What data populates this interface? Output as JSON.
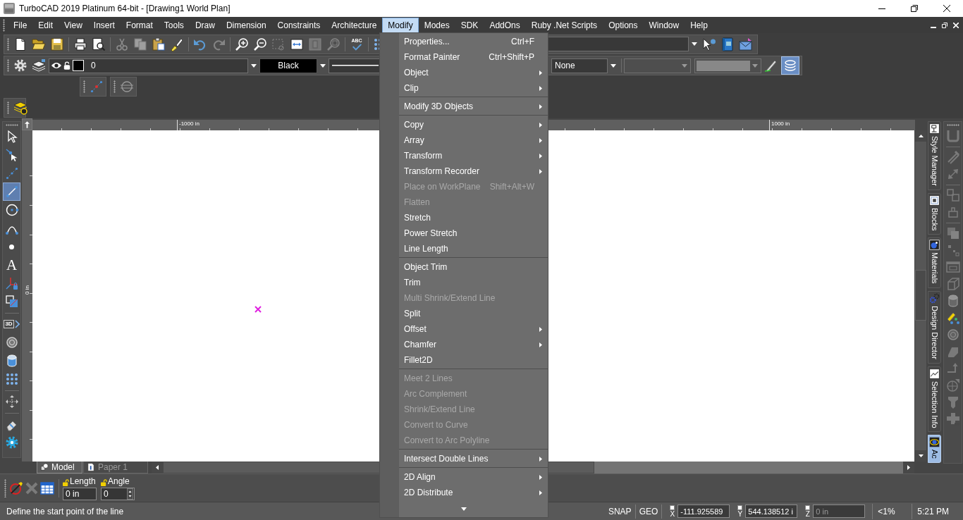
{
  "title_bar": {
    "title": "TurboCAD 2019 Platinum 64-bit - [Drawing1 World Plan]"
  },
  "menu_bar": {
    "items": [
      {
        "label": "File",
        "selected": false
      },
      {
        "label": "Edit",
        "selected": false
      },
      {
        "label": "View",
        "selected": false
      },
      {
        "label": "Insert",
        "selected": false
      },
      {
        "label": "Format",
        "selected": false
      },
      {
        "label": "Tools",
        "selected": false
      },
      {
        "label": "Draw",
        "selected": false
      },
      {
        "label": "Dimension",
        "selected": false
      },
      {
        "label": "Constraints",
        "selected": false
      },
      {
        "label": "Architecture",
        "selected": false
      },
      {
        "label": "Modify",
        "selected": true
      },
      {
        "label": "Modes",
        "selected": false
      },
      {
        "label": "SDK",
        "selected": false
      },
      {
        "label": "AddOns",
        "selected": false
      },
      {
        "label": "Ruby .Net Scripts",
        "selected": false
      },
      {
        "label": "Options",
        "selected": false
      },
      {
        "label": "Window",
        "selected": false
      },
      {
        "label": "Help",
        "selected": false
      }
    ]
  },
  "modify_menu": {
    "more_below": true,
    "items": [
      {
        "kind": "item",
        "label": "Properties...",
        "shortcut": "Ctrl+F",
        "submenu": false,
        "disabled": false
      },
      {
        "kind": "item",
        "label": "Format Painter",
        "shortcut": "Ctrl+Shift+P",
        "submenu": false,
        "disabled": false
      },
      {
        "kind": "item",
        "label": "Object",
        "submenu": true,
        "disabled": false
      },
      {
        "kind": "item",
        "label": "Clip",
        "submenu": true,
        "disabled": false
      },
      {
        "kind": "separator"
      },
      {
        "kind": "item",
        "label": "Modify 3D Objects",
        "submenu": true,
        "disabled": false
      },
      {
        "kind": "separator"
      },
      {
        "kind": "item",
        "label": "Copy",
        "submenu": true,
        "disabled": false
      },
      {
        "kind": "item",
        "label": "Array",
        "submenu": true,
        "disabled": false
      },
      {
        "kind": "item",
        "label": "Transform",
        "submenu": true,
        "disabled": false
      },
      {
        "kind": "item",
        "label": "Transform Recorder",
        "submenu": true,
        "disabled": false
      },
      {
        "kind": "item",
        "label": "Place on WorkPlane",
        "shortcut": "Shift+Alt+W",
        "submenu": false,
        "disabled": true
      },
      {
        "kind": "item",
        "label": "Flatten",
        "submenu": false,
        "disabled": true
      },
      {
        "kind": "item",
        "label": "Stretch",
        "submenu": false,
        "disabled": false
      },
      {
        "kind": "item",
        "label": "Power Stretch",
        "submenu": false,
        "disabled": false
      },
      {
        "kind": "item",
        "label": "Line Length",
        "submenu": false,
        "disabled": false
      },
      {
        "kind": "separator"
      },
      {
        "kind": "item",
        "label": "Object Trim",
        "submenu": false,
        "disabled": false
      },
      {
        "kind": "item",
        "label": "Trim",
        "submenu": false,
        "disabled": false
      },
      {
        "kind": "item",
        "label": "Multi Shrink/Extend Line",
        "submenu": false,
        "disabled": true
      },
      {
        "kind": "item",
        "label": "Split",
        "submenu": false,
        "disabled": false
      },
      {
        "kind": "item",
        "label": "Offset",
        "submenu": true,
        "disabled": false
      },
      {
        "kind": "item",
        "label": "Chamfer",
        "submenu": true,
        "disabled": false
      },
      {
        "kind": "item",
        "label": "Fillet2D",
        "submenu": false,
        "disabled": false
      },
      {
        "kind": "separator"
      },
      {
        "kind": "item",
        "label": "Meet 2 Lines",
        "submenu": false,
        "disabled": true
      },
      {
        "kind": "item",
        "label": "Arc Complement",
        "submenu": false,
        "disabled": true
      },
      {
        "kind": "item",
        "label": "Shrink/Extend Line",
        "submenu": false,
        "disabled": true
      },
      {
        "kind": "item",
        "label": "Convert to Curve",
        "submenu": false,
        "disabled": true
      },
      {
        "kind": "item",
        "label": "Convert to Arc Polyline",
        "submenu": false,
        "disabled": true
      },
      {
        "kind": "separator"
      },
      {
        "kind": "item",
        "label": "Intersect Double Lines",
        "submenu": true,
        "disabled": false
      },
      {
        "kind": "separator"
      },
      {
        "kind": "item",
        "label": "2D Align",
        "submenu": true,
        "disabled": false
      },
      {
        "kind": "item",
        "label": "2D Distribute",
        "submenu": true,
        "disabled": false
      }
    ]
  },
  "standard_toolbar": {
    "items": [
      {
        "kind": "new",
        "disabled": false
      },
      {
        "kind": "open",
        "disabled": false
      },
      {
        "kind": "save",
        "disabled": false
      },
      {
        "kind": "separator"
      },
      {
        "kind": "print",
        "disabled": false
      },
      {
        "kind": "preview",
        "disabled": false
      },
      {
        "kind": "separator"
      },
      {
        "kind": "cut",
        "disabled": true
      },
      {
        "kind": "copy",
        "disabled": true
      },
      {
        "kind": "paste",
        "disabled": false
      },
      {
        "kind": "painter",
        "disabled": false
      },
      {
        "kind": "separator"
      },
      {
        "kind": "undo",
        "disabled": false
      },
      {
        "kind": "redo",
        "disabled": true
      },
      {
        "kind": "separator"
      },
      {
        "kind": "zoomin",
        "disabled": false
      },
      {
        "kind": "zoomout",
        "disabled": false
      },
      {
        "kind": "zoomwindow",
        "disabled": true
      },
      {
        "kind": "extents",
        "disabled": false
      },
      {
        "kind": "page",
        "disabled": true
      },
      {
        "kind": "previous",
        "disabled": true
      },
      {
        "kind": "separator"
      },
      {
        "kind": "spelling",
        "glyph": "ABC",
        "disabled": false
      },
      {
        "kind": "separator"
      },
      {
        "kind": "grid",
        "disabled": false
      }
    ],
    "right_items": [
      {
        "kind": "help",
        "disabled": false
      },
      {
        "kind": "book",
        "disabled": false
      },
      {
        "kind": "mail",
        "disabled": false
      }
    ]
  },
  "property_toolbar": {
    "tools": [
      {
        "kind": "settings",
        "disabled": false
      },
      {
        "kind": "layers",
        "disabled": false
      }
    ],
    "layer_combo": {
      "value": "0"
    },
    "color_combo": {
      "value": "Black"
    },
    "combo_3": {
      "value": "None"
    },
    "right_tools": [
      {
        "kind": "pencil",
        "selected": false
      },
      {
        "kind": "discs",
        "selected": true
      }
    ]
  },
  "toolbox": [
    {
      "kind": "select",
      "selected": false
    },
    {
      "kind": "node",
      "selected": false
    },
    {
      "kind": "dotted",
      "selected": false
    },
    {
      "kind": "line",
      "selected": true
    },
    {
      "kind": "circle",
      "selected": false
    },
    {
      "kind": "curve",
      "selected": false
    },
    {
      "kind": "point",
      "selected": false
    },
    {
      "kind": "text",
      "glyph": "A",
      "selected": false
    },
    {
      "kind": "axes",
      "selected": false
    },
    {
      "kind": "shapes",
      "selected": false
    },
    {
      "kind": "separator"
    },
    {
      "kind": "solid",
      "glyph": "3D",
      "selected": false
    },
    {
      "kind": "sphere",
      "selected": false
    },
    {
      "kind": "cylinder",
      "selected": false
    },
    {
      "kind": "grid",
      "selected": false
    },
    {
      "kind": "separator"
    },
    {
      "kind": "move",
      "selected": false
    },
    {
      "kind": "separator"
    },
    {
      "kind": "eraser",
      "selected": false
    },
    {
      "kind": "gear",
      "selected": false
    }
  ],
  "right_toolbox": [
    {
      "kind": "ushape",
      "disabled": true
    },
    {
      "kind": "separator"
    },
    {
      "kind": "tools",
      "disabled": true
    },
    {
      "kind": "diagonal",
      "disabled": true
    },
    {
      "kind": "separator"
    },
    {
      "kind": "linked",
      "disabled": true
    },
    {
      "kind": "box",
      "disabled": true
    },
    {
      "kind": "separator"
    },
    {
      "kind": "stacked",
      "disabled": true
    },
    {
      "kind": "scatter",
      "disabled": true
    },
    {
      "kind": "window",
      "disabled": true
    },
    {
      "kind": "cube",
      "disabled": true
    },
    {
      "kind": "cylinder",
      "disabled": true
    },
    {
      "kind": "markers",
      "disabled": false
    },
    {
      "kind": "sphere",
      "disabled": true
    },
    {
      "kind": "wedge",
      "disabled": true
    },
    {
      "kind": "bent",
      "disabled": true
    },
    {
      "kind": "globearrow",
      "disabled": true
    },
    {
      "kind": "screw",
      "disabled": true
    },
    {
      "kind": "plus",
      "disabled": true
    }
  ],
  "palette_tabs": [
    {
      "kind": "stamp",
      "label": "Style Manager",
      "selected": false
    },
    {
      "kind": "blocks",
      "label": "Blocks",
      "selected": false
    },
    {
      "kind": "materials",
      "label": "Materials",
      "selected": false
    },
    {
      "kind": "gears",
      "label": "Design Director",
      "selected": false
    },
    {
      "kind": "picture",
      "label": "Selection Info",
      "selected": false
    },
    {
      "kind": "orbit",
      "label": "Ac",
      "selected": true
    }
  ],
  "rulers": {
    "top_labels": [
      "-1000 in",
      "1000 in"
    ],
    "left_label": "0 in"
  },
  "document_tabs": [
    {
      "kind": "model",
      "label": "Model",
      "selected": true
    },
    {
      "kind": "paper",
      "label": "Paper 1",
      "selected": false
    }
  ],
  "inspector_bar": {
    "tools": [
      {
        "kind": "linepen",
        "disabled": false
      },
      {
        "kind": "cancel",
        "disabled": true
      },
      {
        "kind": "table",
        "disabled": false
      }
    ],
    "fields": [
      {
        "kind": "text",
        "label": "Length",
        "value": "0 in"
      },
      {
        "kind": "spin",
        "label": "Angle",
        "value": "0"
      }
    ]
  },
  "status_bar": {
    "message": "Define the start point of the line",
    "toggles": [
      "SNAP",
      "GEO"
    ],
    "coordinates": [
      {
        "axis": "X",
        "value": "-111.925589",
        "checked": false,
        "disabled": false
      },
      {
        "axis": "Y",
        "value": "544.138512 i",
        "checked": false,
        "disabled": false
      },
      {
        "axis": "Z",
        "value": "0 in",
        "checked": false,
        "disabled": true
      }
    ],
    "memory": "<1%",
    "time": "5:21 PM"
  }
}
